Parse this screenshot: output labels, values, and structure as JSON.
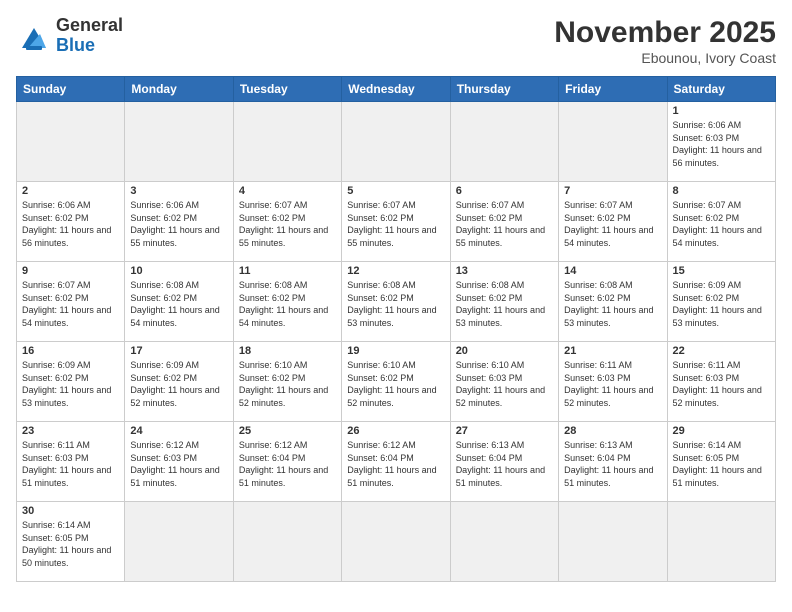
{
  "header": {
    "logo_line1": "General",
    "logo_line2": "Blue",
    "title": "November 2025",
    "subtitle": "Ebounou, Ivory Coast"
  },
  "weekdays": [
    "Sunday",
    "Monday",
    "Tuesday",
    "Wednesday",
    "Thursday",
    "Friday",
    "Saturday"
  ],
  "weeks": [
    [
      {
        "day": "",
        "empty": true
      },
      {
        "day": "",
        "empty": true
      },
      {
        "day": "",
        "empty": true
      },
      {
        "day": "",
        "empty": true
      },
      {
        "day": "",
        "empty": true
      },
      {
        "day": "",
        "empty": true
      },
      {
        "day": "1",
        "sunrise": "6:06 AM",
        "sunset": "6:03 PM",
        "daylight": "11 hours and 56 minutes."
      }
    ],
    [
      {
        "day": "2",
        "sunrise": "6:06 AM",
        "sunset": "6:02 PM",
        "daylight": "11 hours and 56 minutes."
      },
      {
        "day": "3",
        "sunrise": "6:06 AM",
        "sunset": "6:02 PM",
        "daylight": "11 hours and 55 minutes."
      },
      {
        "day": "4",
        "sunrise": "6:07 AM",
        "sunset": "6:02 PM",
        "daylight": "11 hours and 55 minutes."
      },
      {
        "day": "5",
        "sunrise": "6:07 AM",
        "sunset": "6:02 PM",
        "daylight": "11 hours and 55 minutes."
      },
      {
        "day": "6",
        "sunrise": "6:07 AM",
        "sunset": "6:02 PM",
        "daylight": "11 hours and 55 minutes."
      },
      {
        "day": "7",
        "sunrise": "6:07 AM",
        "sunset": "6:02 PM",
        "daylight": "11 hours and 54 minutes."
      },
      {
        "day": "8",
        "sunrise": "6:07 AM",
        "sunset": "6:02 PM",
        "daylight": "11 hours and 54 minutes."
      }
    ],
    [
      {
        "day": "9",
        "sunrise": "6:07 AM",
        "sunset": "6:02 PM",
        "daylight": "11 hours and 54 minutes."
      },
      {
        "day": "10",
        "sunrise": "6:08 AM",
        "sunset": "6:02 PM",
        "daylight": "11 hours and 54 minutes."
      },
      {
        "day": "11",
        "sunrise": "6:08 AM",
        "sunset": "6:02 PM",
        "daylight": "11 hours and 54 minutes."
      },
      {
        "day": "12",
        "sunrise": "6:08 AM",
        "sunset": "6:02 PM",
        "daylight": "11 hours and 53 minutes."
      },
      {
        "day": "13",
        "sunrise": "6:08 AM",
        "sunset": "6:02 PM",
        "daylight": "11 hours and 53 minutes."
      },
      {
        "day": "14",
        "sunrise": "6:08 AM",
        "sunset": "6:02 PM",
        "daylight": "11 hours and 53 minutes."
      },
      {
        "day": "15",
        "sunrise": "6:09 AM",
        "sunset": "6:02 PM",
        "daylight": "11 hours and 53 minutes."
      }
    ],
    [
      {
        "day": "16",
        "sunrise": "6:09 AM",
        "sunset": "6:02 PM",
        "daylight": "11 hours and 53 minutes."
      },
      {
        "day": "17",
        "sunrise": "6:09 AM",
        "sunset": "6:02 PM",
        "daylight": "11 hours and 52 minutes."
      },
      {
        "day": "18",
        "sunrise": "6:10 AM",
        "sunset": "6:02 PM",
        "daylight": "11 hours and 52 minutes."
      },
      {
        "day": "19",
        "sunrise": "6:10 AM",
        "sunset": "6:02 PM",
        "daylight": "11 hours and 52 minutes."
      },
      {
        "day": "20",
        "sunrise": "6:10 AM",
        "sunset": "6:03 PM",
        "daylight": "11 hours and 52 minutes."
      },
      {
        "day": "21",
        "sunrise": "6:11 AM",
        "sunset": "6:03 PM",
        "daylight": "11 hours and 52 minutes."
      },
      {
        "day": "22",
        "sunrise": "6:11 AM",
        "sunset": "6:03 PM",
        "daylight": "11 hours and 52 minutes."
      }
    ],
    [
      {
        "day": "23",
        "sunrise": "6:11 AM",
        "sunset": "6:03 PM",
        "daylight": "11 hours and 51 minutes."
      },
      {
        "day": "24",
        "sunrise": "6:12 AM",
        "sunset": "6:03 PM",
        "daylight": "11 hours and 51 minutes."
      },
      {
        "day": "25",
        "sunrise": "6:12 AM",
        "sunset": "6:04 PM",
        "daylight": "11 hours and 51 minutes."
      },
      {
        "day": "26",
        "sunrise": "6:12 AM",
        "sunset": "6:04 PM",
        "daylight": "11 hours and 51 minutes."
      },
      {
        "day": "27",
        "sunrise": "6:13 AM",
        "sunset": "6:04 PM",
        "daylight": "11 hours and 51 minutes."
      },
      {
        "day": "28",
        "sunrise": "6:13 AM",
        "sunset": "6:04 PM",
        "daylight": "11 hours and 51 minutes."
      },
      {
        "day": "29",
        "sunrise": "6:14 AM",
        "sunset": "6:05 PM",
        "daylight": "11 hours and 51 minutes."
      }
    ],
    [
      {
        "day": "30",
        "sunrise": "6:14 AM",
        "sunset": "6:05 PM",
        "daylight": "11 hours and 50 minutes."
      },
      {
        "day": "",
        "empty": true
      },
      {
        "day": "",
        "empty": true
      },
      {
        "day": "",
        "empty": true
      },
      {
        "day": "",
        "empty": true
      },
      {
        "day": "",
        "empty": true
      },
      {
        "day": "",
        "empty": true
      }
    ]
  ]
}
